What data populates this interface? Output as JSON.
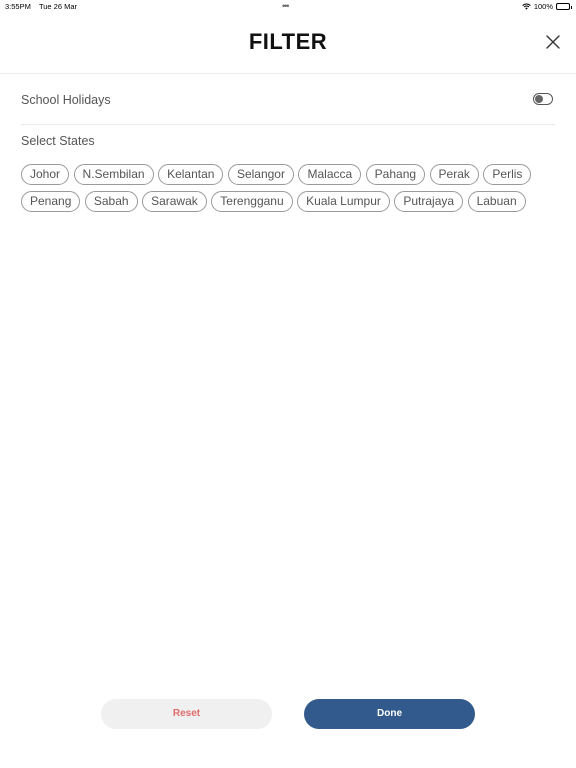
{
  "status_bar": {
    "time": "3:55PM",
    "date": "Tue 26 Mar",
    "dots": "•••",
    "battery": "100%"
  },
  "header": {
    "title": "FILTER"
  },
  "school_holidays": {
    "label": "School Holidays",
    "enabled": false
  },
  "states": {
    "label": "Select States",
    "items": [
      "Johor",
      "N.Sembilan",
      "Kelantan",
      "Selangor",
      "Malacca",
      "Pahang",
      "Perak",
      "Perlis",
      "Penang",
      "Sabah",
      "Sarawak",
      "Terengganu",
      "Kuala Lumpur",
      "Putrajaya",
      "Labuan"
    ]
  },
  "footer": {
    "reset_label": "Reset",
    "done_label": "Done"
  },
  "colors": {
    "done_bg": "#325a8c",
    "reset_text": "#e06c6c"
  }
}
